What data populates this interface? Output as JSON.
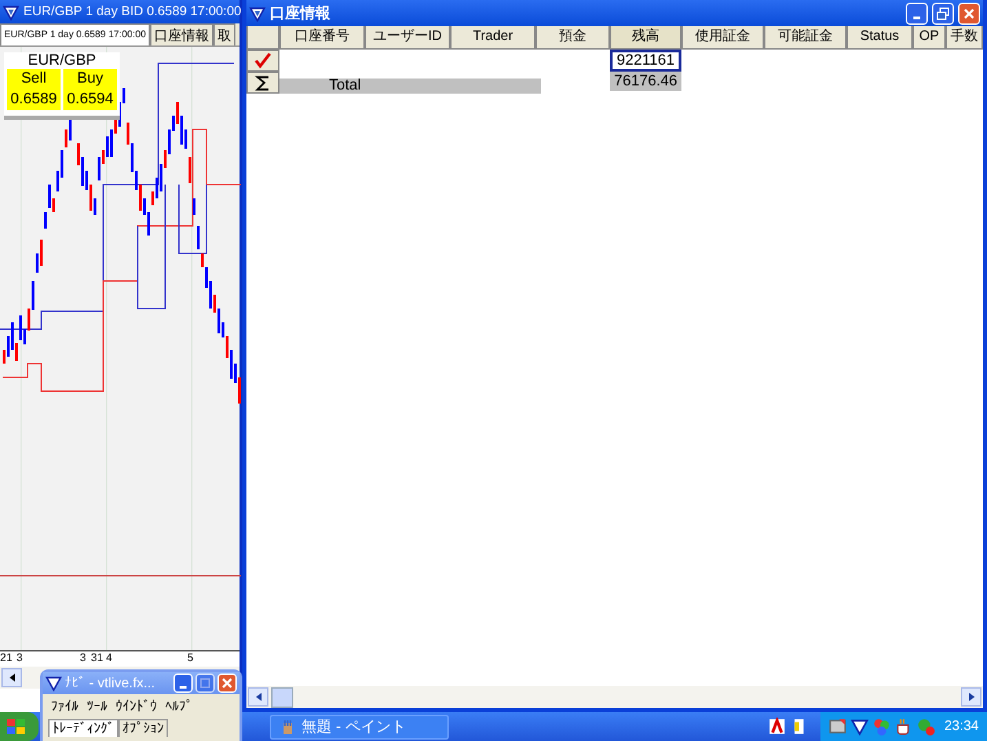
{
  "chart_window": {
    "title": "EUR/GBP 1 day BID 0.6589 17:00:00",
    "tabs": [
      {
        "label": "EUR/GBP 1 day 0.6589 17:00:00",
        "selected": true
      },
      {
        "label": "口座情報",
        "selected": false
      },
      {
        "label": "取",
        "selected": false
      }
    ],
    "quote": {
      "symbol": "EUR/GBP",
      "sell_label": "Sell",
      "buy_label": "Buy",
      "sell": "0.6589",
      "buy": "0.6594"
    },
    "x_labels": [
      "21",
      "3",
      "3",
      "31",
      "4",
      "5"
    ]
  },
  "account_window": {
    "title": "口座情報",
    "columns": [
      "口座番号",
      "ユーザーID",
      "Trader",
      "預金",
      "残高",
      "使用証金",
      "可能証金",
      "Status",
      "OP",
      "手数"
    ],
    "rows": [
      {
        "kind": "account",
        "balance": "9221161",
        "selected": true
      },
      {
        "kind": "total",
        "label": "Total",
        "balance": "76176.46",
        "selected": false
      }
    ]
  },
  "navigator": {
    "title": "ﾅﾋﾞ - vtlive.fx...",
    "menu": [
      "ﾌｧｲﾙ",
      "ﾂｰﾙ",
      "ｳｲﾝﾄﾞｳ",
      "ﾍﾙﾌﾟ"
    ],
    "tabs": [
      {
        "label": "ﾄﾚｰﾃﾞｨﾝｸﾞ",
        "selected": true
      },
      {
        "label": "ｵﾌﾟｼｮﾝ",
        "selected": false
      }
    ]
  },
  "taskbar": {
    "tasks": [
      {
        "label": "無題 - ペイント"
      }
    ],
    "clock": "23:34"
  }
}
